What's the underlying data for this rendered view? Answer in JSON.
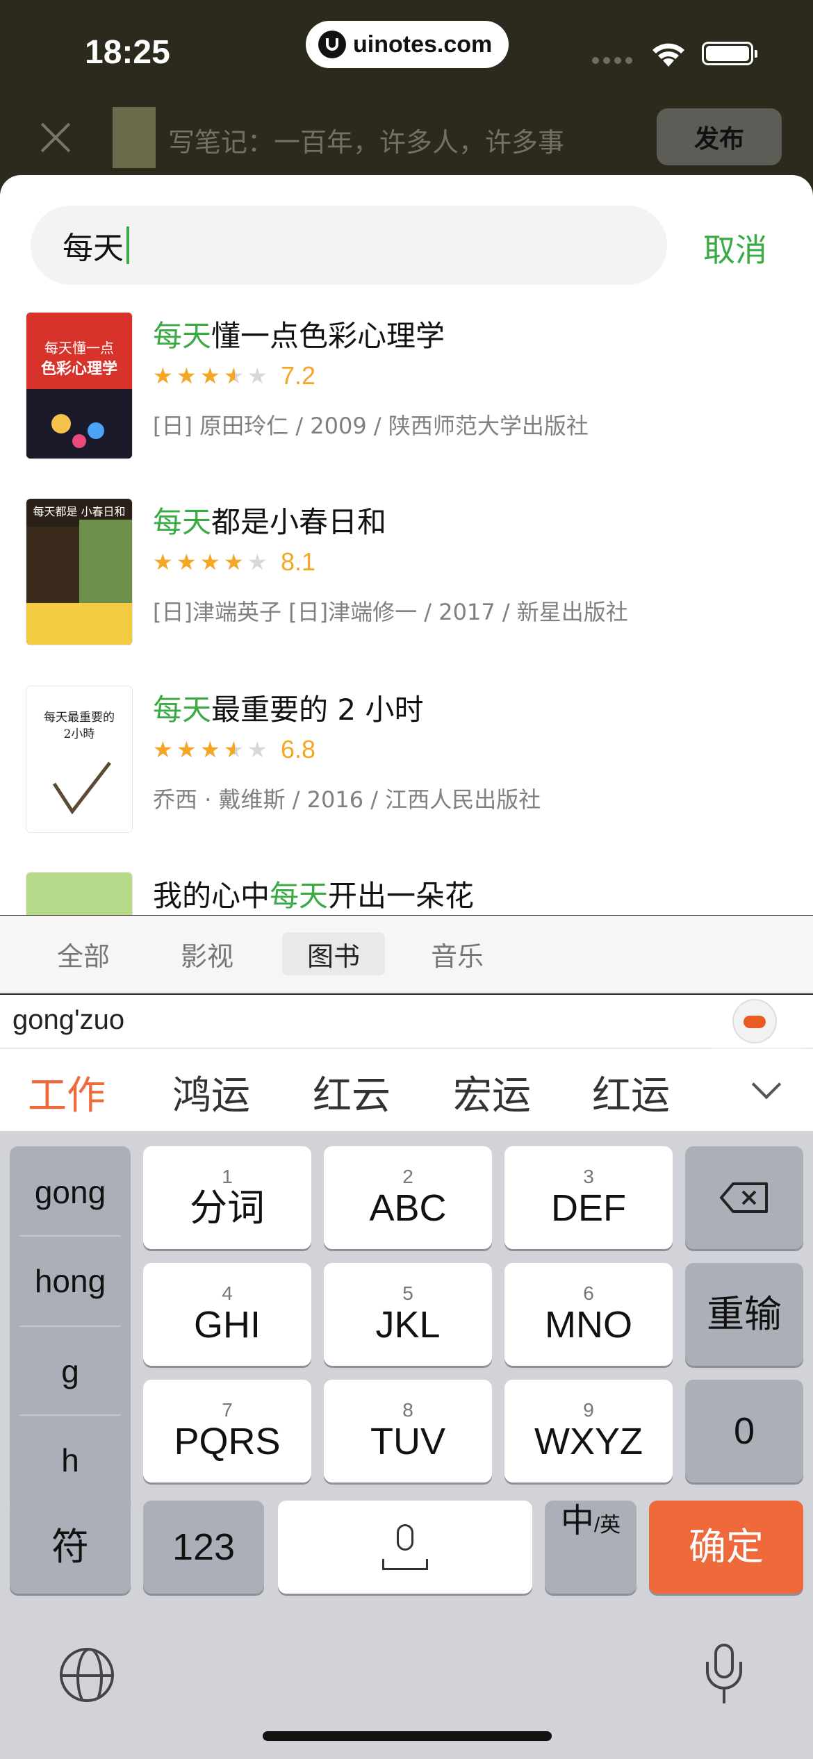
{
  "status_bar": {
    "time": "18:25",
    "url": "uinotes.com"
  },
  "editor_header": {
    "title": "写笔记：一百年，许多人，许多事",
    "publish_label": "发布"
  },
  "search": {
    "query": "每天",
    "cancel_label": "取消"
  },
  "results": [
    {
      "title_highlight": "每天",
      "title_rest": "懂一点色彩心理学",
      "title_prefix": "",
      "rating": 7.2,
      "stars": 3.5,
      "score": "7.2",
      "meta": "[日] 原田玲仁 / 2009 / 陕西师范大学出版社",
      "cover_title": "每天懂一点 色彩心理学",
      "cover_color": "#d8332b"
    },
    {
      "title_highlight": "每天",
      "title_rest": "都是小春日和",
      "title_prefix": "",
      "rating": 8.1,
      "stars": 4,
      "score": "8.1",
      "meta": "[日]津端英子 [日]津端修一 / 2017 / 新星出版社",
      "cover_title": "每天都是小春日和",
      "cover_color": "#2a2017"
    },
    {
      "title_highlight": "每天",
      "title_rest": "最重要的 2 小时",
      "title_prefix": "",
      "rating": 6.8,
      "stars": 3.5,
      "score": "6.8",
      "meta": "乔西 · 戴维斯 / 2016 / 江西人民出版社",
      "cover_title": "每天最重要的 2小時",
      "cover_color": "#ffffff"
    },
    {
      "title_prefix": "我的心中",
      "title_highlight": "每天",
      "title_rest": "开出一朵花",
      "cover_color": "#b7d98a"
    }
  ],
  "tabs": [
    {
      "label": "全部",
      "active": false
    },
    {
      "label": "影视",
      "active": false
    },
    {
      "label": "图书",
      "active": true
    },
    {
      "label": "音乐",
      "active": false
    }
  ],
  "keyboard": {
    "composing": "gong'zuo",
    "candidates": [
      "工作",
      "鸿运",
      "红云",
      "宏运",
      "红运"
    ],
    "pinyin_options": [
      "gong",
      "hong",
      "g",
      "h"
    ],
    "keys": [
      {
        "num": "1",
        "label": "分词"
      },
      {
        "num": "2",
        "label": "ABC"
      },
      {
        "num": "3",
        "label": "DEF"
      },
      {
        "num": "4",
        "label": "GHI"
      },
      {
        "num": "5",
        "label": "JKL"
      },
      {
        "num": "6",
        "label": "MNO"
      },
      {
        "num": "7",
        "label": "PQRS"
      },
      {
        "num": "8",
        "label": "TUV"
      },
      {
        "num": "9",
        "label": "WXYZ"
      }
    ],
    "retype_label": "重输",
    "zero_label": "0",
    "symbol_label": "符",
    "numbers_label": "123",
    "lang_main": "中",
    "lang_sub": "/英",
    "confirm_label": "确定"
  },
  "icons": {
    "close": "close-icon",
    "wifi": "wifi-icon",
    "battery": "battery-icon",
    "backspace": "backspace-icon",
    "globe": "globe-icon",
    "mic": "microphone-icon"
  },
  "colors": {
    "accent_green": "#3aaa45",
    "star": "#f5a623",
    "confirm": "#ef6a3b"
  }
}
